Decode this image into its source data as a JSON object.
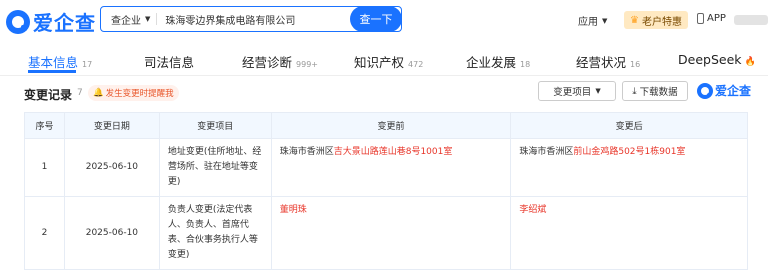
{
  "header": {
    "brand": "爱企查",
    "search_scope": "查企业",
    "search_value": "珠海零边界集成电路有限公司",
    "search_button": "查一下",
    "apps_label": "应用",
    "vip_label": "老户特惠",
    "app_link": "APP"
  },
  "tabs": [
    {
      "label": "基本信息",
      "count": "17"
    },
    {
      "label": "司法信息",
      "count": ""
    },
    {
      "label": "经营诊断",
      "count": "999+"
    },
    {
      "label": "知识产权",
      "count": "472"
    },
    {
      "label": "企业发展",
      "count": "18"
    },
    {
      "label": "经营状况",
      "count": "16"
    },
    {
      "label": "DeepSeek",
      "count": ""
    }
  ],
  "section": {
    "title": "变更记录",
    "count": "7",
    "remind": "发生变更时提醒我",
    "filter_label": "变更项目",
    "download_label": "下载数据",
    "watermark": "爱企查"
  },
  "table": {
    "headers": [
      "序号",
      "变更日期",
      "变更项目",
      "变更前",
      "变更后"
    ],
    "rows": [
      {
        "no": "1",
        "date": "2025-06-10",
        "item": "地址变更(住所地址、经营场所、驻在地址等变更)",
        "before_plain": "珠海市香洲区",
        "before_red": "吉大景山路莲山巷8号1001室",
        "after_plain": "珠海市香洲区",
        "after_red": "前山金鸡路502号1栋901室"
      },
      {
        "no": "2",
        "date": "2025-06-10",
        "item": "负责人变更(法定代表人、负责人、首席代表、合伙事务执行人等变更)",
        "before_plain": "",
        "before_red": "董明珠",
        "after_plain": "",
        "after_red": "李绍斌"
      }
    ]
  }
}
